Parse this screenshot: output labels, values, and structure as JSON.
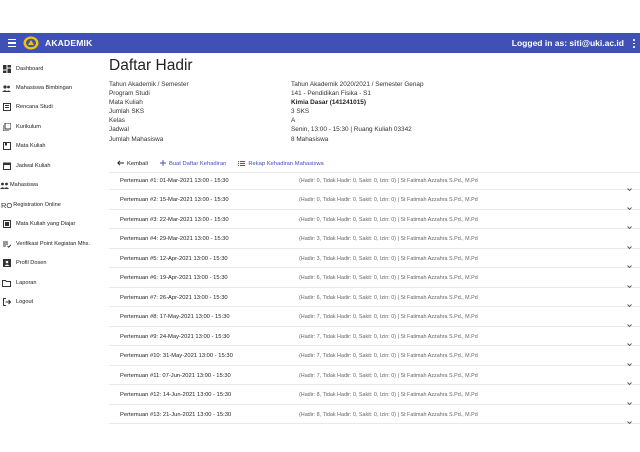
{
  "app": {
    "title": "AKADEMIK",
    "logged_in_label": "Logged in as: siti@uki.ac.id"
  },
  "sidebar": {
    "items": [
      {
        "label": "Dashboard",
        "icon": "dashboard-icon"
      },
      {
        "label": "Mahasiswa Bimbingan",
        "icon": "people-icon"
      },
      {
        "label": "Rencana Studi",
        "icon": "book-icon"
      },
      {
        "label": "Kurikulum",
        "icon": "library-icon"
      },
      {
        "label": "Mata Kuliah",
        "icon": "class-icon"
      },
      {
        "label": "Jadwal Kuliah",
        "icon": "calendar-icon"
      },
      {
        "label": "Mahasiswa",
        "icon": "group-icon"
      },
      {
        "label": "Registration Online",
        "icon": "ro-icon",
        "icon_text": "RO"
      },
      {
        "label": "Mata Kuliah yang Diajar",
        "icon": "teach-icon"
      },
      {
        "label": "Verifikasi Point Kegiatan Mhs.",
        "icon": "checklist-icon"
      },
      {
        "label": "Profil Dosen",
        "icon": "profile-icon"
      },
      {
        "label": "Laporan",
        "icon": "folder-icon"
      },
      {
        "label": "Logout",
        "icon": "logout-icon"
      }
    ]
  },
  "main": {
    "title": "Daftar Hadir",
    "info": [
      {
        "label": "Tahun Akademik / Semester",
        "value": "Tahun Akademik 2020/2021 / Semester Genap"
      },
      {
        "label": "Program Studi",
        "value": "141 - Pendidikan Fisika - S1"
      },
      {
        "label": "Mata Kuliah",
        "value": "Kimia Dasar (141241015)"
      },
      {
        "label": "Jumlah SKS",
        "value": "3 SKS"
      },
      {
        "label": "Kelas",
        "value": "A"
      },
      {
        "label": "Jadwal",
        "value": "Senin, 13:00 - 15:30 | Ruang Kuliah 03342"
      },
      {
        "label": "Jumlah Mahasiswa",
        "value": "8 Mahasiswa"
      }
    ],
    "actions": {
      "back": "Kembali",
      "create": "Buat Daftar Kehadiran",
      "recap": "Rekap Kehadiran Mahasiswa"
    },
    "meetings": [
      {
        "title": "Pertemuan #1: 01-Mar-2021 13:00 - 15:30",
        "detail": "(Hadir: 0, Tidak Hadir: 0, Sakit: 0, Izin: 0) | St Fatimah Azzahra S.Pd., M.Pd"
      },
      {
        "title": "Pertemuan #2: 15-Mar-2021 13:00 - 15:30",
        "detail": "(Hadir: 0, Tidak Hadir: 0, Sakit: 0, Izin: 0) | St Fatimah Azzahra S.Pd., M.Pd"
      },
      {
        "title": "Pertemuan #3: 22-Mar-2021 13:00 - 15:30",
        "detail": "(Hadir: 0, Tidak Hadir: 0, Sakit: 0, Izin: 0) | St Fatimah Azzahra S.Pd., M.Pd"
      },
      {
        "title": "Pertemuan #4: 29-Mar-2021 13:00 - 15:30",
        "detail": "(Hadir: 3, Tidak Hadir: 0, Sakit: 0, Izin: 0) | St Fatimah Azzahra S.Pd., M.Pd"
      },
      {
        "title": "Pertemuan #5: 12-Apr-2021 13:00 - 15:30",
        "detail": "(Hadir: 3, Tidak Hadir: 0, Sakit: 0, Izin: 0) | St Fatimah Azzahra S.Pd., M.Pd"
      },
      {
        "title": "Pertemuan #6: 19-Apr-2021 13:00 - 15:30",
        "detail": "(Hadir: 6, Tidak Hadir: 0, Sakit: 0, Izin: 0) | St Fatimah Azzahra S.Pd., M.Pd"
      },
      {
        "title": "Pertemuan #7: 26-Apr-2021 13:00 - 15:30",
        "detail": "(Hadir: 6, Tidak Hadir: 0, Sakit: 0, Izin: 0) | St Fatimah Azzahra S.Pd., M.Pd"
      },
      {
        "title": "Pertemuan #8: 17-May-2021 13:00 - 15:30",
        "detail": "(Hadir: 7, Tidak Hadir: 0, Sakit: 0, Izin: 0) | St Fatimah Azzahra S.Pd., M.Pd"
      },
      {
        "title": "Pertemuan #9: 24-May-2021 13:00 - 15:30",
        "detail": "(Hadir: 7, Tidak Hadir: 0, Sakit: 0, Izin: 0) | St Fatimah Azzahra S.Pd., M.Pd"
      },
      {
        "title": "Pertemuan #10: 31-May-2021 13:00 - 15:30",
        "detail": "(Hadir: 7, Tidak Hadir: 0, Sakit: 0, Izin: 0) | St Fatimah Azzahra S.Pd., M.Pd"
      },
      {
        "title": "Pertemuan #11: 07-Jun-2021 13:00 - 15:30",
        "detail": "(Hadir: 7, Tidak Hadir: 0, Sakit: 0, Izin: 0) | St Fatimah Azzahra S.Pd., M.Pd"
      },
      {
        "title": "Pertemuan #12: 14-Jun-2021 13:00 - 15:30",
        "detail": "(Hadir: 8, Tidak Hadir: 0, Sakit: 0, Izin: 0) | St Fatimah Azzahra S.Pd., M.Pd"
      },
      {
        "title": "Pertemuan #13: 21-Jun-2021 13:00 - 15:30",
        "detail": "(Hadir: 8, Tidak Hadir: 0, Sakit: 0, Izin: 0) | St Fatimah Azzahra S.Pd., M.Pd"
      }
    ]
  },
  "colors": {
    "primary": "#3f51b5",
    "link": "#3f51b5",
    "text": "#222222",
    "muted": "#666666"
  }
}
